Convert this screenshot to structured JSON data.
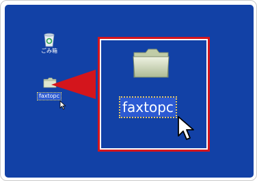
{
  "desktop": {
    "background_color": "#1241a6",
    "recycle_bin": {
      "label": "ごみ箱",
      "icon": "recycle-bin-icon"
    },
    "folder": {
      "label": "faxtopc",
      "icon": "folder-icon",
      "selected": true
    }
  },
  "zoom_callout": {
    "border_color": "#d4151c",
    "folder_label": "faxtopc",
    "icon": "folder-icon"
  },
  "cursor": {
    "icon": "mouse-pointer-icon"
  }
}
